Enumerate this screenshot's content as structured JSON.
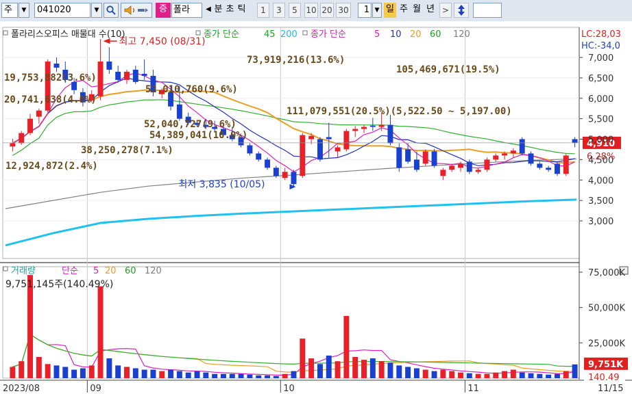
{
  "toolbar": {
    "type_value": "주",
    "code_value": "041020",
    "zoom_tag": "증",
    "stock_name_short": "폴라",
    "period_labels": [
      "분",
      "초",
      "틱"
    ],
    "interval_buttons": [
      "1",
      "3",
      "5",
      "10",
      "20",
      "30"
    ],
    "count_value": "1",
    "timeframe_selected": "일",
    "timeframe_others": [
      "주",
      "월",
      "년"
    ],
    "next_label": ">"
  },
  "price_panel": {
    "legend_name": "폴라리스오피스 매물대 수(10)",
    "legend_ma_long_label": "종가 단순",
    "legend_ma_long_periods": [
      "45",
      "200"
    ],
    "legend_ma_short_label": "종가 단순",
    "legend_ma_short_periods": [
      "5",
      "10",
      "20",
      "60",
      "120"
    ],
    "right_top_1": "LC:28,03",
    "right_top_2": "HC:-34,0",
    "current_price_label": "4,910",
    "current_change_label": "6.28%",
    "high_label": "최고 7,450 (08/31)",
    "low_label": "최저 3,835 (10/05)",
    "volume_profile_labels": [
      "73,919,216(13.6%)",
      "105,469,671(19.5%)",
      "19,753,882(3.6%)",
      "52,010,760(9.6%)",
      "20,741,638(4.0%)",
      "111,079,551(20.5%)(5,522.50 ~ 5,197.00)",
      "52,040,727(9.6%)",
      "54,389,041(10.0%)",
      "38,250,278(7.1%)",
      "12,924,872(2.4%)"
    ],
    "y_ticks": [
      "7,000",
      "6,500",
      "6,000",
      "5,500",
      "5,000",
      "4,500",
      "4,000",
      "3,500",
      "3,000"
    ]
  },
  "volume_panel": {
    "legend_name": "거래량",
    "legend_ma_label": "단순",
    "legend_ma_periods": [
      "5",
      "20",
      "60",
      "120"
    ],
    "last_volume_label": "9,751,145주(140.49%)",
    "current_volume_tag": "9,751K",
    "current_ratio_tag": "140.49",
    "y_ticks": [
      "75,000K",
      "50,000K",
      "25,000K"
    ]
  },
  "x_axis_labels": [
    "2023/08",
    "09",
    "10",
    "11",
    "11/15"
  ],
  "colors": {
    "up": "#e8202a",
    "down": "#1a40d0",
    "ma5": "#e020c0",
    "ma10": "#2030c0",
    "ma20": "#e8a020",
    "ma45": "#30b030",
    "ma60": "#30b030",
    "ma120": "#808080",
    "ma200": "#20c0f0",
    "profile_band": "#f5e0c8"
  },
  "chart_data": {
    "type": "candlestick",
    "y_range": [
      2500,
      7450
    ],
    "volume_range_k": [
      0,
      75000
    ],
    "candles": [
      {
        "o": 4820,
        "h": 5010,
        "l": 4700,
        "c": 4900
      },
      {
        "o": 4900,
        "h": 5200,
        "l": 4860,
        "c": 5150
      },
      {
        "o": 5150,
        "h": 5620,
        "l": 5100,
        "c": 5500
      },
      {
        "o": 5550,
        "h": 5750,
        "l": 5380,
        "c": 5700
      },
      {
        "o": 5700,
        "h": 6950,
        "l": 5650,
        "c": 6900
      },
      {
        "o": 6850,
        "h": 7000,
        "l": 6650,
        "c": 6750
      },
      {
        "o": 6700,
        "h": 6900,
        "l": 6380,
        "c": 6450
      },
      {
        "o": 6400,
        "h": 6500,
        "l": 6100,
        "c": 6200
      },
      {
        "o": 6150,
        "h": 6250,
        "l": 5800,
        "c": 5900
      },
      {
        "o": 5950,
        "h": 6200,
        "l": 5900,
        "c": 6100
      },
      {
        "o": 6050,
        "h": 7450,
        "l": 5950,
        "c": 6900
      },
      {
        "o": 6900,
        "h": 7250,
        "l": 6600,
        "c": 6700
      },
      {
        "o": 6650,
        "h": 6800,
        "l": 6380,
        "c": 6450
      },
      {
        "o": 6450,
        "h": 6700,
        "l": 6350,
        "c": 6650
      },
      {
        "o": 6700,
        "h": 6800,
        "l": 6350,
        "c": 6400
      },
      {
        "o": 6600,
        "h": 6950,
        "l": 6450,
        "c": 6550
      },
      {
        "o": 6550,
        "h": 6700,
        "l": 6050,
        "c": 6150
      },
      {
        "o": 6100,
        "h": 6250,
        "l": 6000,
        "c": 6200
      },
      {
        "o": 6150,
        "h": 6300,
        "l": 5700,
        "c": 5800
      },
      {
        "o": 5850,
        "h": 6300,
        "l": 5450,
        "c": 5500
      },
      {
        "o": 5550,
        "h": 5650,
        "l": 5350,
        "c": 5400
      },
      {
        "o": 5400,
        "h": 5450,
        "l": 5300,
        "c": 5350
      },
      {
        "o": 5350,
        "h": 5500,
        "l": 5250,
        "c": 5300
      },
      {
        "o": 5300,
        "h": 5450,
        "l": 5200,
        "c": 5250
      },
      {
        "o": 5250,
        "h": 5300,
        "l": 5050,
        "c": 5100
      },
      {
        "o": 5100,
        "h": 5300,
        "l": 4950,
        "c": 5000
      },
      {
        "o": 5050,
        "h": 5100,
        "l": 4800,
        "c": 4850
      },
      {
        "o": 4850,
        "h": 4900,
        "l": 4600,
        "c": 4650
      },
      {
        "o": 4650,
        "h": 4700,
        "l": 4450,
        "c": 4500
      },
      {
        "o": 4500,
        "h": 4550,
        "l": 4250,
        "c": 4300
      },
      {
        "o": 4300,
        "h": 4350,
        "l": 4050,
        "c": 4100
      },
      {
        "o": 4050,
        "h": 4300,
        "l": 4000,
        "c": 4200
      },
      {
        "o": 4200,
        "h": 4250,
        "l": 3835,
        "c": 3900
      },
      {
        "o": 4100,
        "h": 5150,
        "l": 4050,
        "c": 5100
      },
      {
        "o": 5000,
        "h": 5150,
        "l": 4880,
        "c": 5080
      },
      {
        "o": 5000,
        "h": 5050,
        "l": 4450,
        "c": 4500
      },
      {
        "o": 5050,
        "h": 5400,
        "l": 4550,
        "c": 5000
      },
      {
        "o": 4700,
        "h": 4850,
        "l": 4550,
        "c": 4800
      },
      {
        "o": 4750,
        "h": 5250,
        "l": 4700,
        "c": 5200
      },
      {
        "o": 5200,
        "h": 5320,
        "l": 5050,
        "c": 5250
      },
      {
        "o": 5250,
        "h": 5350,
        "l": 5150,
        "c": 5300
      },
      {
        "o": 5330,
        "h": 5520,
        "l": 5200,
        "c": 5300
      },
      {
        "o": 5300,
        "h": 5650,
        "l": 5200,
        "c": 5350
      },
      {
        "o": 5350,
        "h": 5600,
        "l": 4850,
        "c": 4900
      },
      {
        "o": 4800,
        "h": 4900,
        "l": 4200,
        "c": 4300
      },
      {
        "o": 4750,
        "h": 4900,
        "l": 4400,
        "c": 4450
      },
      {
        "o": 4500,
        "h": 4700,
        "l": 4200,
        "c": 4250
      },
      {
        "o": 4400,
        "h": 4750,
        "l": 4350,
        "c": 4700
      },
      {
        "o": 4700,
        "h": 4760,
        "l": 4300,
        "c": 4350
      },
      {
        "o": 4100,
        "h": 4300,
        "l": 4000,
        "c": 4250
      },
      {
        "o": 4250,
        "h": 4400,
        "l": 4200,
        "c": 4350
      },
      {
        "o": 4300,
        "h": 4450,
        "l": 4200,
        "c": 4400
      },
      {
        "o": 4450,
        "h": 4500,
        "l": 4150,
        "c": 4200
      },
      {
        "o": 4200,
        "h": 4300,
        "l": 4150,
        "c": 4250
      },
      {
        "o": 4250,
        "h": 4550,
        "l": 4200,
        "c": 4500
      },
      {
        "o": 4500,
        "h": 4650,
        "l": 4450,
        "c": 4600
      },
      {
        "o": 4600,
        "h": 4700,
        "l": 4500,
        "c": 4650
      },
      {
        "o": 4650,
        "h": 4780,
        "l": 4550,
        "c": 4720
      },
      {
        "o": 5000,
        "h": 5050,
        "l": 4600,
        "c": 4650
      },
      {
        "o": 4650,
        "h": 4700,
        "l": 4350,
        "c": 4400
      },
      {
        "o": 4400,
        "h": 4450,
        "l": 4250,
        "c": 4300
      },
      {
        "o": 4300,
        "h": 4350,
        "l": 4200,
        "c": 4250
      },
      {
        "o": 4400,
        "h": 4450,
        "l": 4100,
        "c": 4150
      },
      {
        "o": 4150,
        "h": 4650,
        "l": 4100,
        "c": 4600
      },
      {
        "o": 5000,
        "h": 5050,
        "l": 4800,
        "c": 4910
      }
    ],
    "volume_k": [
      8000,
      12000,
      73000,
      15000,
      10000,
      9000,
      8000,
      6000,
      7000,
      9000,
      65000,
      14000,
      9000,
      8000,
      7000,
      6000,
      6000,
      5000,
      6000,
      5000,
      4000,
      5000,
      4000,
      3000,
      3000,
      3000,
      3000,
      2500,
      2000,
      2000,
      1500,
      3000,
      5000,
      28000,
      14000,
      10000,
      16000,
      12000,
      44000,
      15000,
      13000,
      14000,
      12000,
      11000,
      9000,
      8000,
      7000,
      6000,
      5000,
      6000,
      5000,
      4000,
      3500,
      3000,
      3000,
      4000,
      5000,
      6000,
      4000,
      3500,
      3000,
      2500,
      3000,
      5000,
      9751
    ],
    "x_label_indices": [
      0,
      9,
      31,
      52,
      64
    ],
    "profile_bands": [
      {
        "lo": 6600,
        "hi": 6800,
        "share_pct": 13.6
      },
      {
        "lo": 6350,
        "hi": 6580,
        "share_pct": 19.5
      },
      {
        "lo": 6150,
        "hi": 6330,
        "share_pct": 3.6
      },
      {
        "lo": 5900,
        "hi": 6130,
        "share_pct": 9.6
      },
      {
        "lo": 5560,
        "hi": 5880,
        "share_pct": 4.0
      },
      {
        "lo": 5197,
        "hi": 5522.5,
        "share_pct": 20.5
      },
      {
        "lo": 5030,
        "hi": 5180,
        "share_pct": 9.6
      },
      {
        "lo": 4820,
        "hi": 5010,
        "share_pct": 10.0
      },
      {
        "lo": 4430,
        "hi": 4800,
        "share_pct": 7.1
      },
      {
        "lo": 3980,
        "hi": 4200,
        "share_pct": 2.4
      }
    ],
    "ma120_points": [
      3300,
      3500,
      3700,
      3850,
      3950,
      4050,
      4120,
      4200,
      4280,
      4350,
      4420,
      4480,
      4520
    ],
    "ma200_points": [
      2400,
      2700,
      2950,
      3050,
      3120,
      3180,
      3230,
      3280,
      3330,
      3380,
      3430,
      3480,
      3520
    ]
  }
}
